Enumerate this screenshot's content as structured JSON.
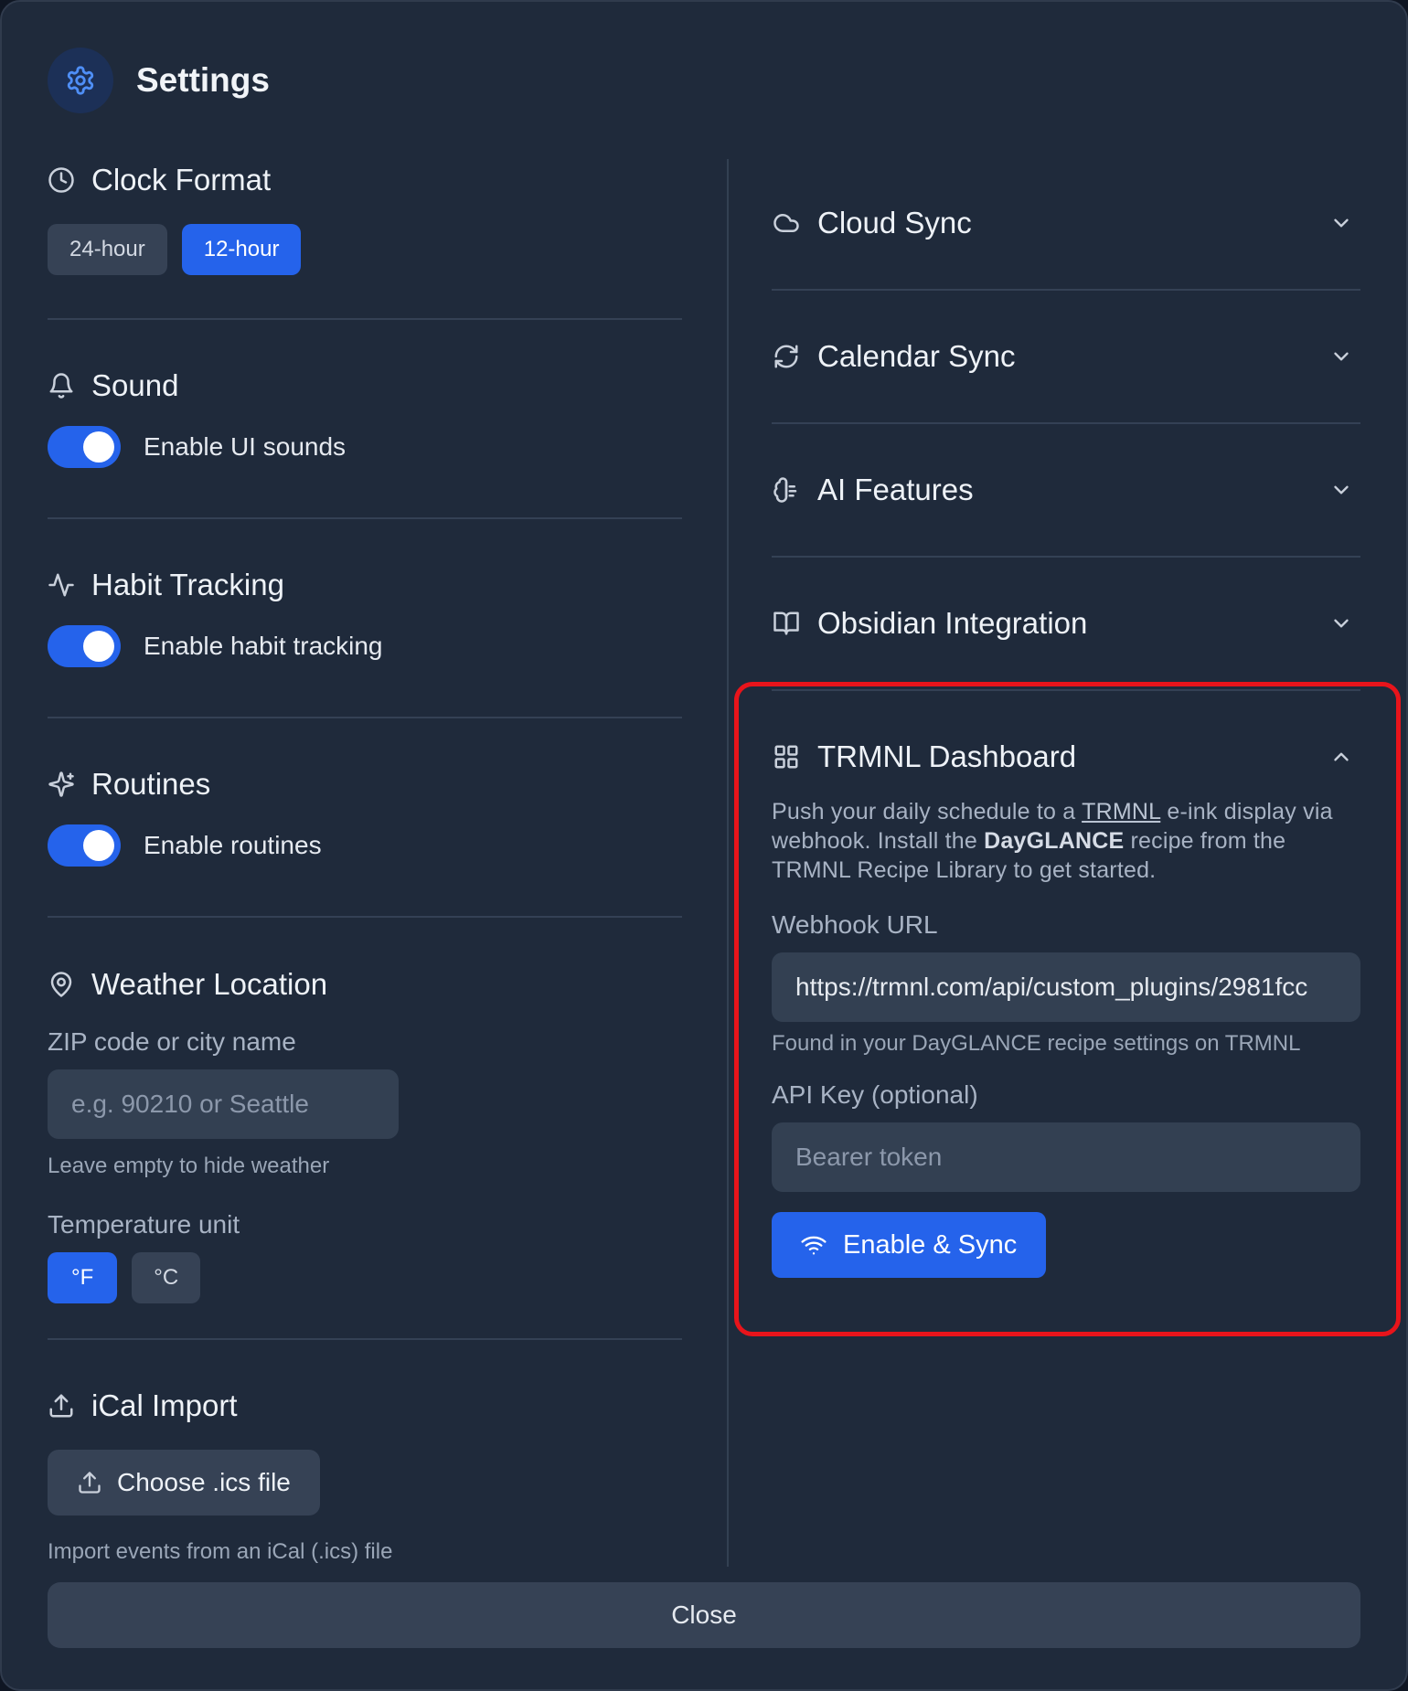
{
  "header": {
    "title": "Settings",
    "icon": "gear-icon"
  },
  "clock": {
    "title": "Clock Format",
    "icon": "clock-icon",
    "options": [
      "24-hour",
      "12-hour"
    ],
    "selected": "12-hour"
  },
  "sound": {
    "title": "Sound",
    "icon": "bell-icon",
    "toggle_label": "Enable UI sounds",
    "enabled": true
  },
  "habit": {
    "title": "Habit Tracking",
    "icon": "activity-icon",
    "toggle_label": "Enable habit tracking",
    "enabled": true
  },
  "routines": {
    "title": "Routines",
    "icon": "sparkles-icon",
    "toggle_label": "Enable routines",
    "enabled": true
  },
  "weather": {
    "title": "Weather Location",
    "icon": "map-pin-icon",
    "location_label": "ZIP code or city name",
    "location_placeholder": "e.g. 90210 or Seattle",
    "location_value": "",
    "location_hint": "Leave empty to hide weather",
    "unit_label": "Temperature unit",
    "units": [
      "°F",
      "°C"
    ],
    "selected_unit": "°F"
  },
  "ical": {
    "title": "iCal Import",
    "icon": "upload-icon",
    "button_label": "Choose .ics file",
    "hint": "Import events from an iCal (.ics) file"
  },
  "accordion": [
    {
      "title": "Cloud Sync",
      "icon": "cloud-icon",
      "expanded": false
    },
    {
      "title": "Calendar Sync",
      "icon": "refresh-icon",
      "expanded": false
    },
    {
      "title": "AI Features",
      "icon": "brain-icon",
      "expanded": false
    },
    {
      "title": "Obsidian Integration",
      "icon": "book-open-icon",
      "expanded": false
    }
  ],
  "trmnl": {
    "title": "TRMNL Dashboard",
    "icon": "grid-icon",
    "expanded": true,
    "desc_part1": "Push your daily schedule to a ",
    "desc_link": "TRMNL",
    "desc_part2": " e-ink display via webhook. Install the ",
    "desc_bold": "DayGLANCE",
    "desc_part3": " recipe from the TRMNL Recipe Library to get started.",
    "webhook_label": "Webhook URL",
    "webhook_value": "https://trmnl.com/api/custom_plugins/2981fcc",
    "webhook_hint": "Found in your DayGLANCE recipe settings on TRMNL",
    "api_label": "API Key (optional)",
    "api_placeholder": "Bearer token",
    "api_value": "",
    "button_label": "Enable & Sync",
    "button_icon": "wifi-icon"
  },
  "footer": {
    "close_label": "Close"
  },
  "colors": {
    "accent": "#2563eb",
    "highlight": "#e8141b",
    "panel": "#1f2a3b"
  }
}
